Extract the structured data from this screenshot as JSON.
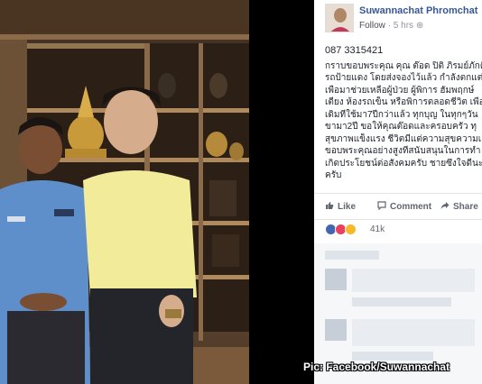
{
  "post": {
    "author": "Suwannachat Phromchat",
    "follow": "Follow",
    "time": "5 hrs",
    "phone": "087 3315421",
    "lines": [
      "กราบขอบพระคุณ คุณ ต๊อด ปิติ ภิรมย์ภักดี",
      "รถป้ายแดง โดยส่งจองไว้แล้ว กำลังตกแต่",
      "เพื่อมาช่วยเหลือผู้ป่วย ผู้พิการ ฮัมพฤกษ์",
      "เตียง ห้องรถเข็น หรือพิการตลอดชีวิต เพื่อ",
      "เดิมที่ใช้มา7ปีกว่าแล้ว ทุกบุญ ในทุกๆวัน",
      "ขามา2ปี ขอให้คุณต๊อดและครอบครัว ทุ",
      "สุขภาพแข็งแรง ชีวิตมีแต่ความสุขความเ",
      "ขอบพระคุณอย่างสูงที่สนับสนุนในการทำ",
      "เกิดประโยชน์ต่อสังคมครับ ชายซึ่งใจดีนะ",
      "ครับ"
    ]
  },
  "actions": {
    "like": "Like",
    "comment": "Comment",
    "share": "Share"
  },
  "reactions": {
    "count": "41k"
  },
  "caption": "Pic: Facebook/Suwannachat",
  "colors": {
    "link": "#365899",
    "like": "#4267b2",
    "love": "#e9415f",
    "haha": "#f7b928"
  }
}
